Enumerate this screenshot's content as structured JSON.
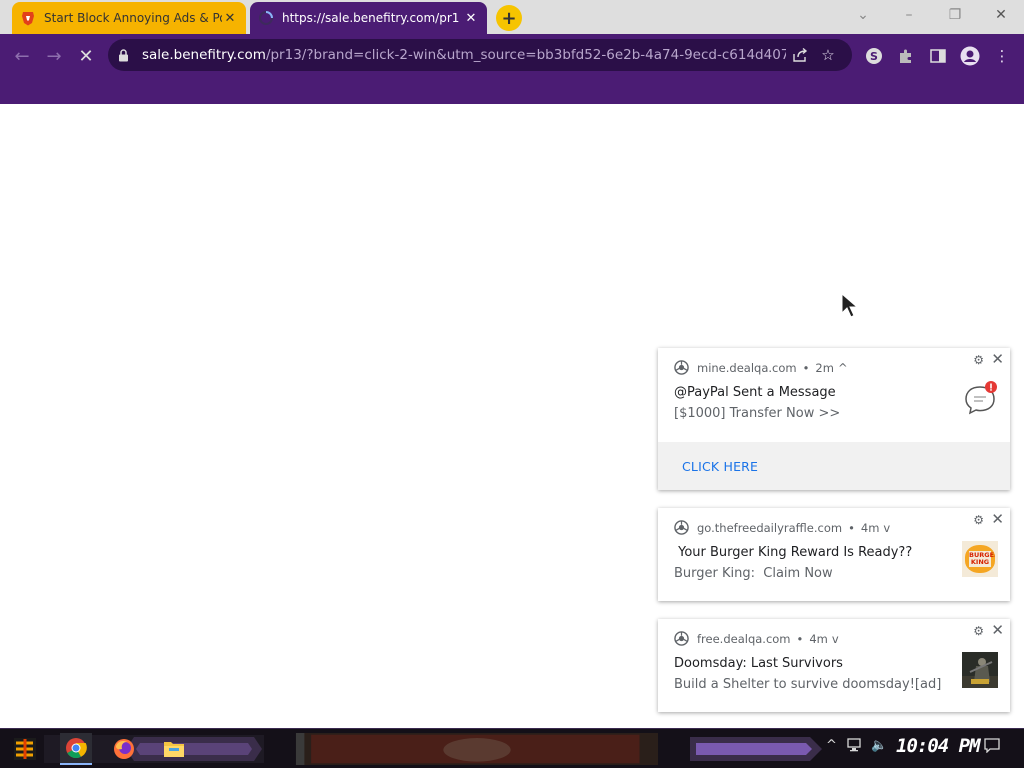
{
  "browser": {
    "tabs": [
      {
        "title": "Start Block Annoying Ads & Po",
        "favicon": "brave-lion-icon",
        "active": false
      },
      {
        "title": "https://sale.benefitry.com/pr1",
        "favicon": "loading-spinner-icon",
        "active": true
      }
    ],
    "new_tab_label": "+",
    "omnibox": {
      "host": "sale.benefitry.com",
      "path": "/pr13/?brand=click-2-win&utm_source=bb3bfd52-6e2b-4a74-9ecd-c614d407..."
    }
  },
  "notifications": [
    {
      "origin": "mine.dealqa.com",
      "age": "2m",
      "expander": "^",
      "title": "@PayPal Sent a Message",
      "body": "[$1000] Transfer Now >>",
      "image": "chat-bubble-alert-icon",
      "action": "CLICK HERE"
    },
    {
      "origin": "go.thefreedailyraffle.com",
      "age": "4m",
      "expander": "v",
      "title": " Your Burger King Reward Is Ready??",
      "body": "Burger King:  Claim Now",
      "image": "burger-king-logo-icon",
      "image_text": "BURGER KING"
    },
    {
      "origin": "free.dealqa.com",
      "age": "4m",
      "expander": "v",
      "title": "Doomsday: Last Survivors",
      "body": "Build a Shelter to survive doomsday![ad]",
      "image": "doomsday-game-thumbnail"
    }
  ],
  "taskbar": {
    "clock": "10:04 PM"
  },
  "colors": {
    "toolbar": "#4b1c74",
    "omnibox": "#2b0f48",
    "inactive_tab": "#f6b300",
    "link_blue": "#1a73e8"
  }
}
